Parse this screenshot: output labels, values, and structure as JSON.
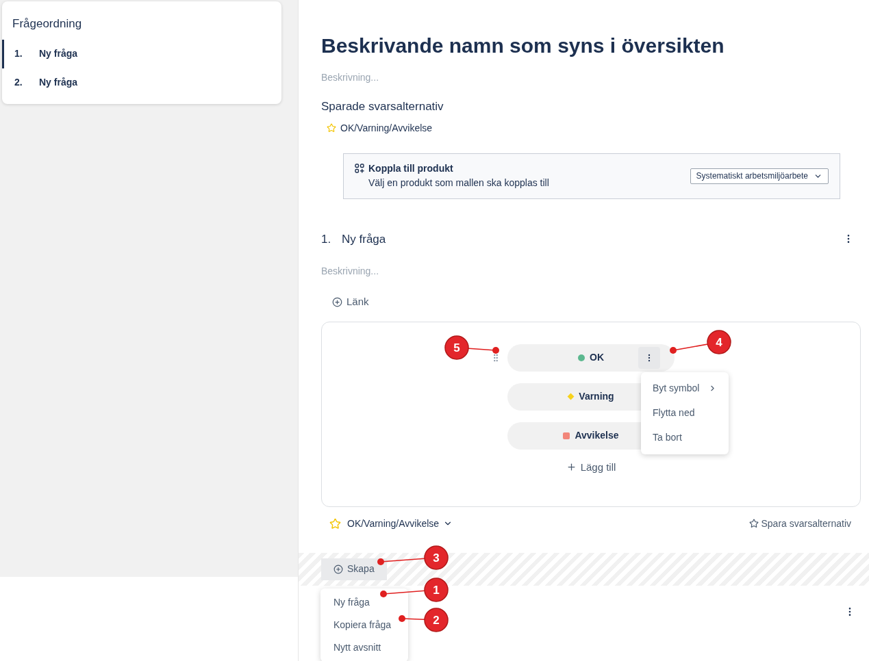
{
  "sidebar": {
    "title": "Frågeordning",
    "items": [
      {
        "number": "1.",
        "label": "Ny fråga",
        "selected": true
      },
      {
        "number": "2.",
        "label": "Ny fråga",
        "selected": false
      }
    ]
  },
  "header": {
    "title": "Beskrivande namn som syns i översikten",
    "placeholder": "Beskrivning..."
  },
  "saved_answers": {
    "heading": "Sparade svarsalternativ",
    "items": [
      {
        "label": "OK/Varning/Avvikelse"
      }
    ]
  },
  "product_link": {
    "title": "Koppla till produkt",
    "subtitle": "Välj en produkt som mallen ska kopplas till",
    "select_value": "Systematiskt arbetsmiljöarbete"
  },
  "question": {
    "number": "1.",
    "title": "Ny fråga",
    "placeholder": "Beskrivning...",
    "link_button": "Länk",
    "answers": [
      {
        "label": "OK",
        "kind": "circle",
        "color": "#5cb88f",
        "menu": [
          {
            "label": "Byt symbol",
            "submenu": true
          },
          {
            "label": "Flytta ned",
            "submenu": false
          },
          {
            "label": "Ta bort",
            "submenu": false
          }
        ]
      },
      {
        "label": "Varning",
        "kind": "diamond",
        "color": "#f7d21c"
      },
      {
        "label": "Avvikelse",
        "kind": "square",
        "color": "#f2867a"
      }
    ],
    "add_button": "Lägg till",
    "answer_set": "OK/Varning/Avvikelse",
    "save_button": "Spara svarsalternativ"
  },
  "create": {
    "button": "Skapa",
    "menu": [
      {
        "label": "Ny fråga"
      },
      {
        "label": "Kopiera fråga"
      },
      {
        "label": "Nytt avsnitt"
      }
    ]
  },
  "callouts": [
    {
      "number": "5"
    },
    {
      "number": "4"
    },
    {
      "number": "3"
    },
    {
      "number": "1"
    },
    {
      "number": "2"
    }
  ]
}
